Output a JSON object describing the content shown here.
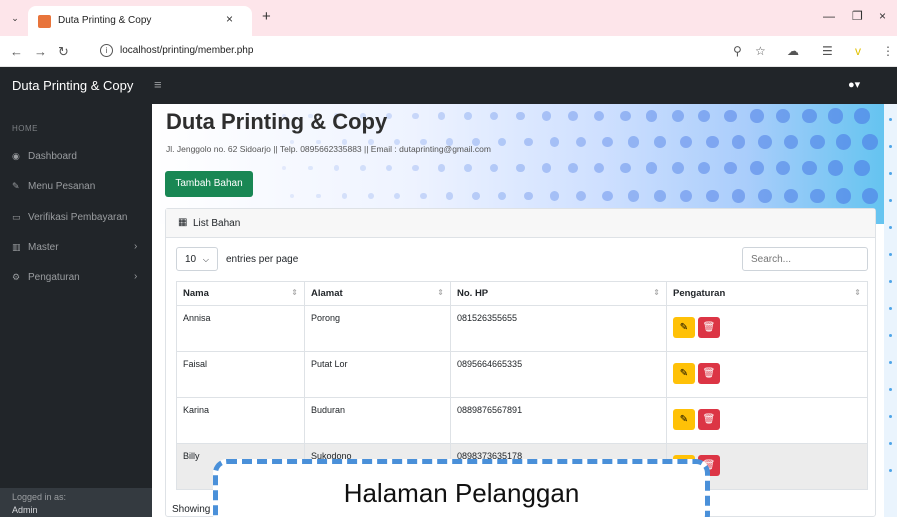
{
  "browser": {
    "tab_title": "Duta Printing & Copy",
    "url": "localhost/printing/member.php"
  },
  "app": {
    "brand": "Duta Printing & Copy"
  },
  "sidebar": {
    "heading": "HOME",
    "items": [
      {
        "label": "Dashboard",
        "icon": "dashboard-icon"
      },
      {
        "label": "Menu Pesanan",
        "icon": "pencil-icon"
      },
      {
        "label": "Verifikasi Pembayaran",
        "icon": "card-icon"
      },
      {
        "label": "Master",
        "icon": "columns-icon"
      },
      {
        "label": "Pengaturan",
        "icon": "gear-icon"
      }
    ],
    "footer_label": "Logged in as:",
    "footer_user": "Admin"
  },
  "hero": {
    "title": "Duta Printing & Copy",
    "subtitle": "Jl. Jenggolo no. 62 Sidoarjo || Telp. 0895662335883 || Email : dutaprinting@gmail.com",
    "add_button": "Tambah Bahan"
  },
  "card": {
    "title": "List Bahan",
    "per_page_value": "10",
    "per_page_label": "entries per page",
    "search_placeholder": "Search..."
  },
  "table": {
    "columns": [
      "Nama",
      "Alamat",
      "No. HP",
      "Pengaturan"
    ],
    "rows": [
      {
        "nama": "Annisa",
        "alamat": "Porong",
        "hp": "081526355655"
      },
      {
        "nama": "Faisal",
        "alamat": "Putat Lor",
        "hp": "0895664665335"
      },
      {
        "nama": "Karina",
        "alamat": "Buduran",
        "hp": "0889876567891"
      },
      {
        "nama": "Billy",
        "alamat": "Sukodono",
        "hp": "0898373635178"
      }
    ]
  },
  "footer": {
    "showing": "Showing"
  },
  "callout": {
    "text": "Halaman Pelanggan"
  }
}
